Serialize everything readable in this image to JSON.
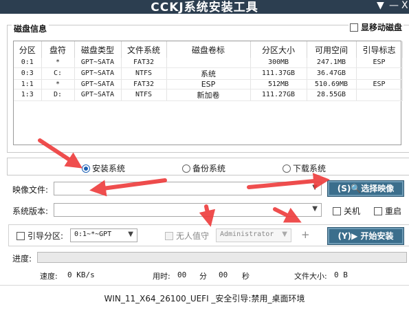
{
  "window": {
    "title": "CCKJ系统安装工具",
    "controls": [
      "▼",
      "—",
      "X"
    ]
  },
  "disk_group": {
    "title": "磁盘信息",
    "show_usb_label": "显移动磁盘",
    "columns": [
      "分区",
      "盘符",
      "磁盘类型",
      "文件系统",
      "磁盘卷标",
      "分区大小",
      "可用空间",
      "引导标志"
    ],
    "rows": [
      [
        "0:1",
        "*",
        "GPT~SATA",
        "FAT32",
        "",
        "300MB",
        "247.1MB",
        "ESP"
      ],
      [
        "0:3",
        "C:",
        "GPT~SATA",
        "NTFS",
        "系统",
        "111.37GB",
        "36.47GB",
        ""
      ],
      [
        "1:1",
        "*",
        "GPT~SATA",
        "FAT32",
        "ESP",
        "512MB",
        "510.69MB",
        "ESP"
      ],
      [
        "1:3",
        "D:",
        "GPT~SATA",
        "NTFS",
        "新加卷",
        "111.27GB",
        "28.55GB",
        ""
      ]
    ]
  },
  "modes": {
    "install": "安装系统",
    "backup": "备份系统",
    "download": "下载系统",
    "selected": "install"
  },
  "image": {
    "label": "映像文件:",
    "value": "",
    "button": "(S)🔍选择映像"
  },
  "version": {
    "label": "系统版本:",
    "value": "",
    "shutdown_label": "关机",
    "restart_label": "重启"
  },
  "boot": {
    "label": "引导分区:",
    "partition_value": "0:1~*~GPT",
    "unattended_label": "无人值守",
    "account_value": "Administrator",
    "add_symbol": "+",
    "start_button": "(Y)▶ 开始安装"
  },
  "progress": {
    "label": "进度:",
    "fraction": 0
  },
  "stats": {
    "speed_label": "速度:",
    "speed_value": "0 KB/s",
    "time_label": "用时:",
    "time_min": "00",
    "min_unit": "分",
    "time_sec": "00",
    "sec_unit": "秒",
    "size_label": "文件大小:",
    "size_value": "0 B"
  },
  "footer": {
    "text": "WIN_11_X64_26100_UEFI _安全引导:禁用_桌面环境"
  },
  "colors": {
    "titlebar": "#2c3e50",
    "button": "#3b6e8c",
    "radio_selected": "#1a5fb4",
    "annotation_arrow": "#ee3b3b"
  }
}
